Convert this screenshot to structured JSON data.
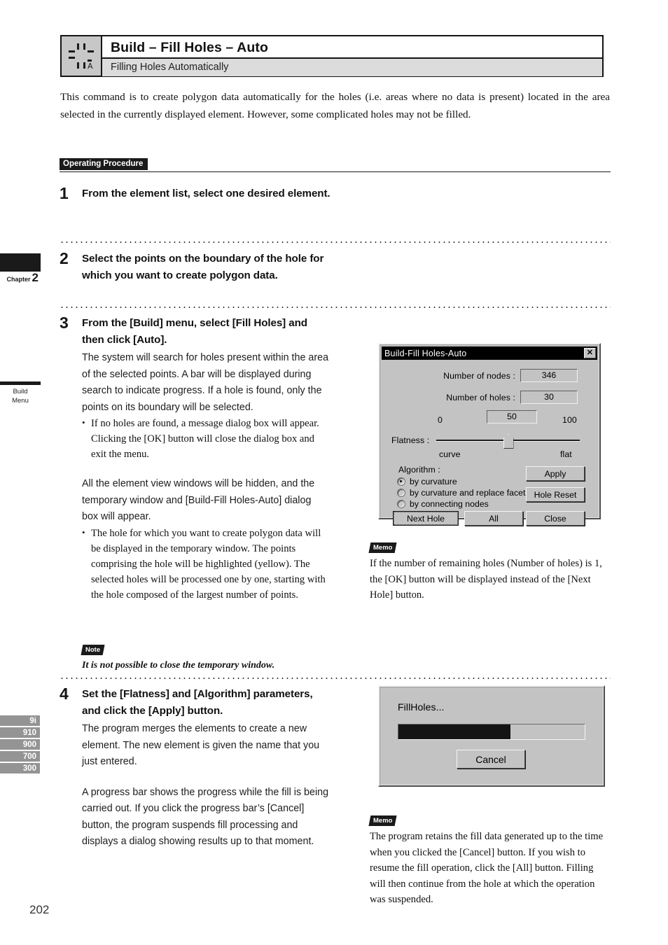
{
  "header": {
    "icon": "fill-holes-auto-icon",
    "title": "Build – Fill Holes – Auto",
    "subtitle": "Filling Holes Automatically"
  },
  "intro": "This command is to create polygon data automatically for the holes (i.e. areas where no data is present) located in the area selected in the currently displayed element. However, some complicated holes may not be filled.",
  "section": {
    "label": "Operating Procedure"
  },
  "steps": [
    {
      "number": "1",
      "heading": "From the element list, select one desired element."
    },
    {
      "number": "2",
      "heading": "Select the points on the boundary of the hole for which you want to create polygon data."
    },
    {
      "number": "3",
      "heading": "From the [Build] menu, select [Fill Holes] and then click [Auto].",
      "para1": "The system will search for holes present within the area of the selected points. A bar will be displayed during search to indicate progress. If a hole is found, only the points on its boundary will be selected.",
      "bullet1": "If no holes are found, a message dialog box will appear. Clicking the [OK] button will close the dialog box and exit the menu.",
      "para2": "All the element view windows will be hidden, and the temporary window and [Build-Fill Holes-Auto] dialog box will appear.",
      "bullet2": "The hole for which you want to create polygon data will be displayed in the temporary window. The points comprising the hole will be highlighted (yellow). The selected holes will be processed one by one, starting with the hole composed of the largest number of points."
    },
    {
      "number": "4",
      "heading": "Set the [Flatness] and [Algorithm] parameters, and click the [Apply] button.",
      "para1": "The program merges the elements to create a new element. The new element is given the name that you just entered.",
      "para2": "A progress bar shows the progress while the fill is being carried out. If you click the progress bar’s [Cancel] button, the program suspends fill processing and displays a dialog showing results up to that moment."
    }
  ],
  "note": {
    "badge": "Note",
    "text": "It is not possible to close the temporary window."
  },
  "memos": [
    {
      "badge": "Memo",
      "text": "If the number of remaining holes (Number of holes) is 1, the [OK] button will be displayed instead of the [Next Hole] button."
    },
    {
      "badge": "Memo",
      "text": "The program retains the fill data generated up to the time when you clicked the [Cancel] button. If you wish to resume the fill operation, click the [All] button. Filling will then continue from the hole at which the operation was suspended."
    }
  ],
  "dialog_main": {
    "title": "Build-Fill Holes-Auto",
    "close_label": "✕",
    "fields": [
      {
        "label": "Number of nodes :",
        "value": "346"
      },
      {
        "label": "Number of holes :",
        "value": "30"
      }
    ],
    "slider": {
      "label": "Flatness :",
      "value": "50",
      "min_label": "0",
      "max_label": "100",
      "left_caption": "curve",
      "right_caption": "flat",
      "percent": 50
    },
    "algorithm": {
      "label": "Algorithm :",
      "options": [
        {
          "label": "by curvature",
          "selected": true
        },
        {
          "label": "by curvature and replace facets",
          "selected": false
        },
        {
          "label": "by connecting nodes",
          "selected": false
        }
      ]
    },
    "buttons": {
      "apply": "Apply",
      "hole_reset": "Hole Reset",
      "next_hole": "Next Hole",
      "all": "All",
      "close": "Close"
    }
  },
  "dialog_progress": {
    "title": "FillHoles...",
    "progress_percent": 60,
    "cancel_label": "Cancel"
  },
  "left_rail": {
    "chapter": {
      "word": "Chapter",
      "number": "2"
    },
    "menu": {
      "line1": "Build",
      "line2": "Menu"
    },
    "models": [
      "9i",
      "910",
      "900",
      "700",
      "300"
    ]
  },
  "page_number": "202"
}
